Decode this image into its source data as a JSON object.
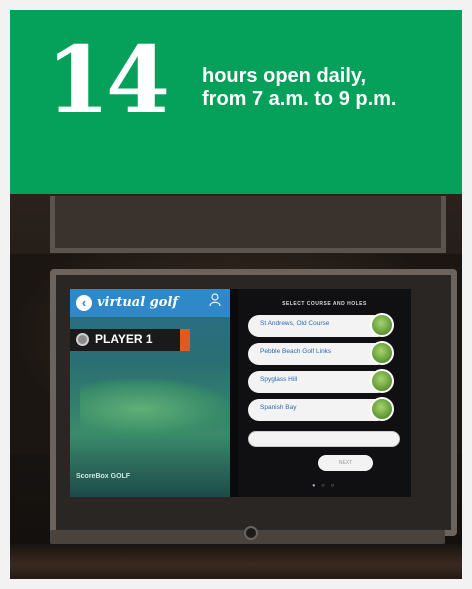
{
  "stat": {
    "number": "14",
    "line1": "hours open daily,",
    "line2": "from 7 a.m. to 9 p.m."
  },
  "colors": {
    "banner": "#05a05a",
    "header_blue": "#2f89c9",
    "player_flag": "#e05a1f"
  },
  "screen": {
    "app_title": "virtual golf",
    "player_label": "PLAYER 1",
    "brand": "ScoreBox GOLF",
    "select_title": "SELECT COURSE AND HOLES",
    "courses": [
      {
        "name": "St Andrews, Old Course"
      },
      {
        "name": "Pebble Beach Golf Links"
      },
      {
        "name": "Spyglass Hill"
      },
      {
        "name": "Spanish Bay"
      }
    ],
    "next_label": "NEXT",
    "page_dots": "● ○ ○"
  }
}
